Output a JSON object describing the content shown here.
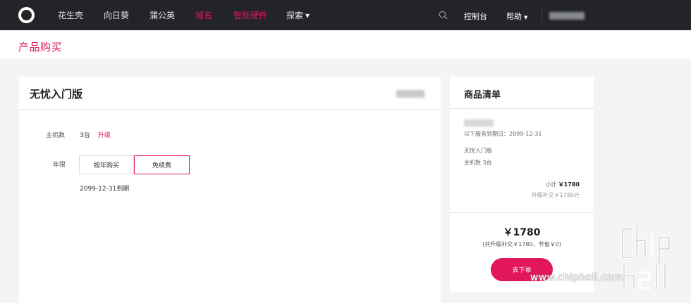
{
  "nav": {
    "items": [
      {
        "label": "花生壳",
        "active": false
      },
      {
        "label": "向日葵",
        "active": false
      },
      {
        "label": "蒲公英",
        "active": false
      },
      {
        "label": "域名",
        "active": true
      },
      {
        "label": "智能硬件",
        "active": true
      },
      {
        "label": "探索",
        "active": false,
        "dropdown": true
      }
    ],
    "console": "控制台",
    "help": "帮助",
    "search_icon": "search-icon",
    "accent": "#e2175b",
    "bg": "#222427"
  },
  "page": {
    "title": "产品购买"
  },
  "product": {
    "title": "无忧入门版",
    "hosts_label": "主机数",
    "hosts_value": "3台",
    "upgrade_link": "升级",
    "term_label": "年限",
    "options": [
      {
        "label": "按年购买",
        "selected": false
      },
      {
        "label": "免续费",
        "selected": true
      }
    ],
    "expiry": "2099-12-31到期"
  },
  "cart": {
    "title": "商品清单",
    "service_until": "以下服务到期日：2099-12-31",
    "item_name": "无忧入门版",
    "item_hosts": "主机数 3台",
    "subtotal_label": "小计",
    "subtotal_value": "￥1780",
    "upgrade_note": "升级补交￥1780元",
    "total": "￥1780",
    "total_note": "(共升级补交￥1780、节省￥0)",
    "order_button": "去下单"
  },
  "watermark": {
    "text": "www.chiphell.com"
  }
}
